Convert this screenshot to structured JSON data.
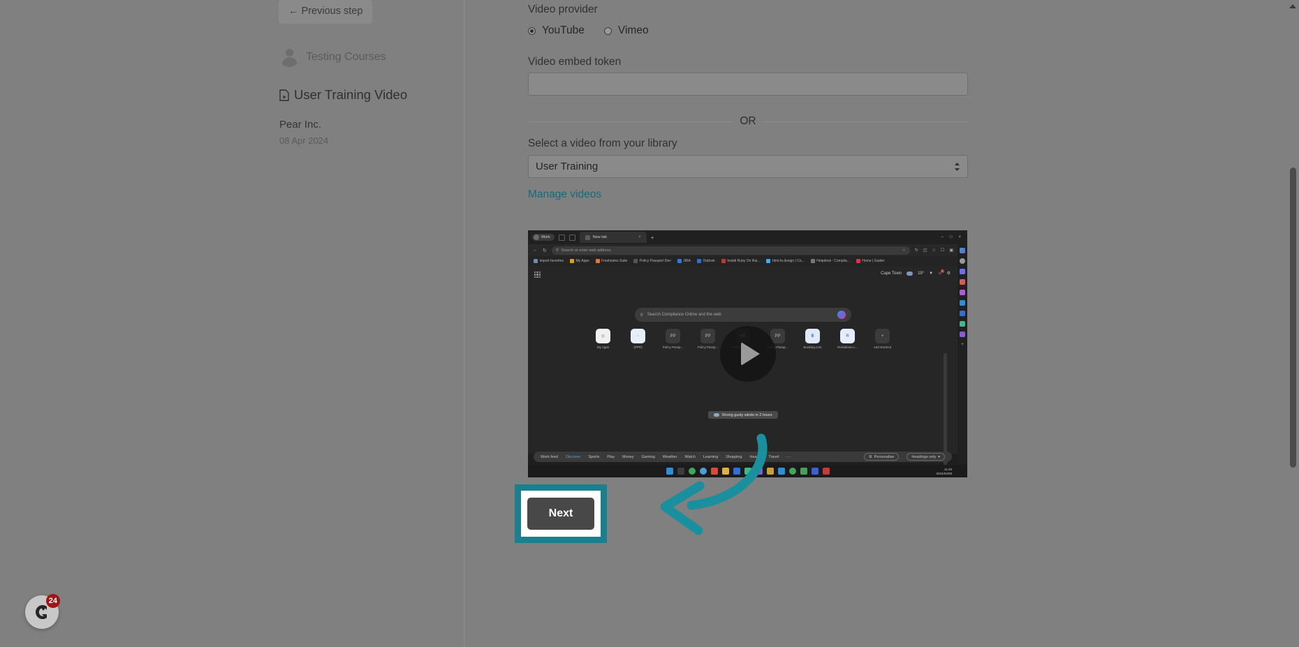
{
  "sidebar": {
    "previous_step_label": "← Previous step",
    "author_name": "Testing Courses",
    "doc_icon": "document-icon",
    "doc_title": "User Training Video",
    "company": "Pear Inc.",
    "date": "08 Apr 2024"
  },
  "form": {
    "provider_label": "Video provider",
    "provider_options": [
      {
        "label": "YouTube",
        "checked": true
      },
      {
        "label": "Vimeo",
        "checked": false
      }
    ],
    "token_label": "Video embed token",
    "token_value": "",
    "token_placeholder": "",
    "or_text": "OR",
    "library_label": "Select a video from your library",
    "library_selected": "User Training",
    "manage_videos_label": "Manage videos",
    "next_label": "Next"
  },
  "video_preview": {
    "browser": {
      "profile_label": "Work",
      "tab_title": "New tab",
      "tab_close": "×",
      "new_tab": "+",
      "window_buttons": [
        "–",
        "□",
        "×"
      ],
      "omnibox_placeholder": "Search or enter web address",
      "bookmarks": [
        "Import favorites",
        "My Apps",
        "Freshsales Suite",
        "Policy Passport Dev",
        "JIRA",
        "Outlook",
        "Install Ruby On Rai...",
        "html.to.design | Co...",
        "Helpdesk : Complia...",
        "Home | Guider"
      ]
    },
    "page": {
      "weather_location": "Cape Town",
      "weather_temp": "19°",
      "notification_count": "1",
      "search_placeholder": "Search Compliance Online and the web",
      "tiles": [
        {
          "name": "My Apps",
          "glyph": ""
        },
        {
          "name": "(PPR)",
          "glyph": ""
        },
        {
          "name": "Policy Passp...",
          "glyph": "PP"
        },
        {
          "name": "Policy Passp...",
          "glyph": "PP"
        },
        {
          "name": "Policy Passp...",
          "glyph": "PP"
        },
        {
          "name": "Policy Passp...",
          "glyph": "PP"
        },
        {
          "name": "Booking.com",
          "glyph": "B"
        },
        {
          "name": "Rentalcars.c...",
          "glyph": "R"
        },
        {
          "name": "Add shortcut",
          "glyph": "+"
        }
      ],
      "toast": "Strong gusty winds in 2 hours",
      "feed_nav": [
        "Work feed",
        "Discover",
        "Sports",
        "Play",
        "Money",
        "Gaming",
        "Weather",
        "Watch",
        "Learning",
        "Shopping",
        "Health",
        "Travel",
        "···"
      ],
      "feed_active": "Discover",
      "personalise_label": "Personalise",
      "headings_label": "Headings only"
    },
    "taskbar": {
      "clock_time": "11:48",
      "clock_date": "2024/04/08"
    },
    "play_button": "play-icon"
  },
  "annotations": {
    "highlight_color": "#1a7f8e",
    "arrow_color": "#1a8f9e"
  },
  "widget": {
    "badge_count": "24",
    "icon": "chat-widget-icon"
  },
  "scrollbar": {
    "up_arrow": "scroll-up-arrow"
  }
}
